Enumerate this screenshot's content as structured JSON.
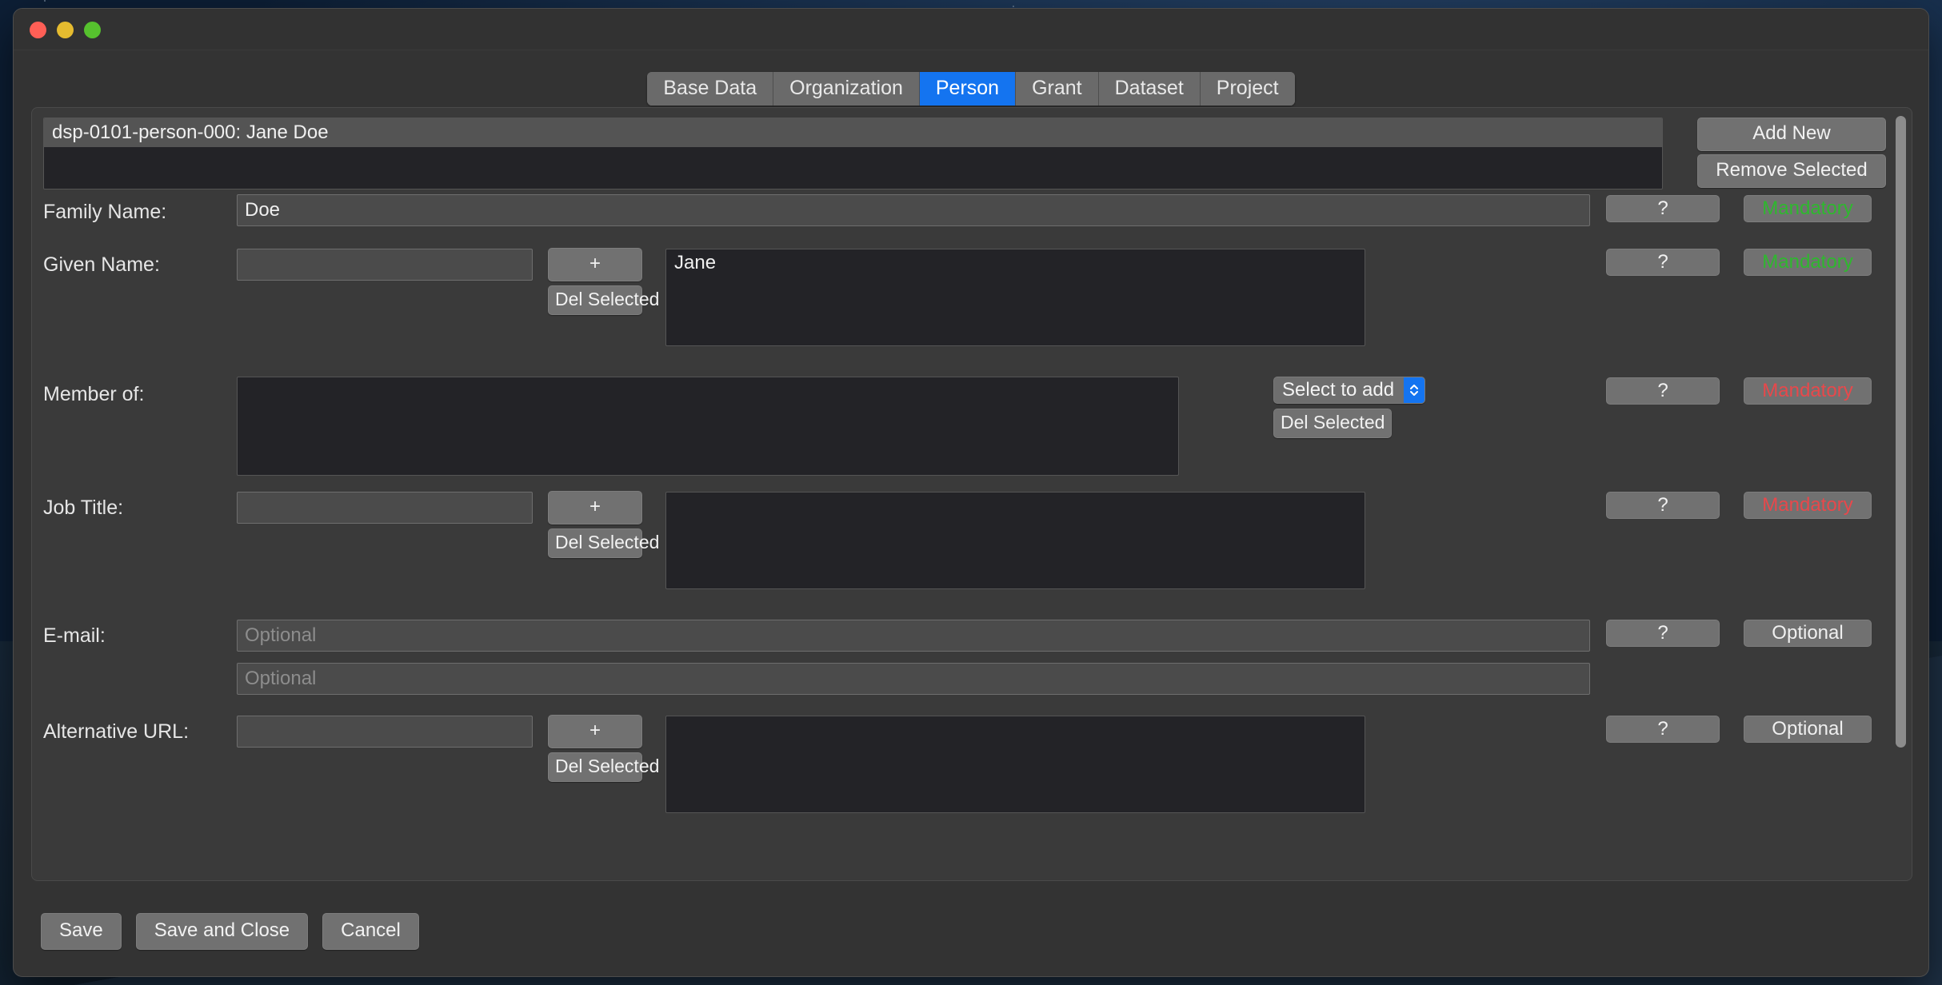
{
  "window": {
    "traffic_lights": [
      "close",
      "minimize",
      "zoom"
    ],
    "colors": {
      "accent": "#1474f0",
      "mandatory_ok": "#2eb82e",
      "mandatory_missing": "#e8484b",
      "optional": "#efefef",
      "panel_bg": "#3a3a3a",
      "list_bg": "#232327",
      "button_bg": "#717171"
    }
  },
  "tabs": [
    {
      "label": "Base Data",
      "active": false
    },
    {
      "label": "Organization",
      "active": false
    },
    {
      "label": "Person",
      "active": true
    },
    {
      "label": "Grant",
      "active": false
    },
    {
      "label": "Dataset",
      "active": false
    },
    {
      "label": "Project",
      "active": false
    }
  ],
  "entity_list": {
    "items": [
      {
        "label": "dsp-0101-person-000: Jane Doe",
        "selected": true
      }
    ],
    "buttons": [
      {
        "label": "Add New"
      },
      {
        "label": "Remove Selected"
      }
    ]
  },
  "common": {
    "help_label": "?",
    "add_label": "+",
    "del_selected_label": "Del Selected",
    "select_to_add_label": "Select to add",
    "optional_placeholder": "Optional"
  },
  "fields": [
    {
      "label": "Family Name:",
      "kind": "text",
      "value": "Doe",
      "help": "?",
      "status": "Mandatory",
      "status_kind": "mandatory-ok"
    },
    {
      "label": "Given Name:",
      "kind": "text-add-list",
      "value": "",
      "add_label": "+",
      "del_label": "Del Selected",
      "list_items": [
        "Jane"
      ],
      "help": "?",
      "status": "Mandatory",
      "status_kind": "mandatory-ok"
    },
    {
      "label": "Member of:",
      "kind": "select-list",
      "select_label": "Select to add",
      "del_label": "Del Selected",
      "list_items": [],
      "help": "?",
      "status": "Mandatory",
      "status_kind": "mandatory-miss"
    },
    {
      "label": "Job Title:",
      "kind": "text-add-list",
      "value": "",
      "add_label": "+",
      "del_label": "Del Selected",
      "list_items": [],
      "help": "?",
      "status": "Mandatory",
      "status_kind": "mandatory-miss"
    },
    {
      "label": "E-mail:",
      "kind": "text-pair",
      "value_1": "",
      "placeholder_1": "Optional",
      "value_2": "",
      "placeholder_2": "Optional",
      "help": "?",
      "status": "Optional",
      "status_kind": "optional"
    },
    {
      "label": "Alternative URL:",
      "kind": "text-add-list",
      "value": "",
      "add_label": "+",
      "del_label": "Del Selected",
      "list_items": [],
      "help": "?",
      "status": "Optional",
      "status_kind": "optional"
    }
  ],
  "footer": {
    "buttons": [
      {
        "label": "Save"
      },
      {
        "label": "Save and Close"
      },
      {
        "label": "Cancel"
      }
    ]
  }
}
